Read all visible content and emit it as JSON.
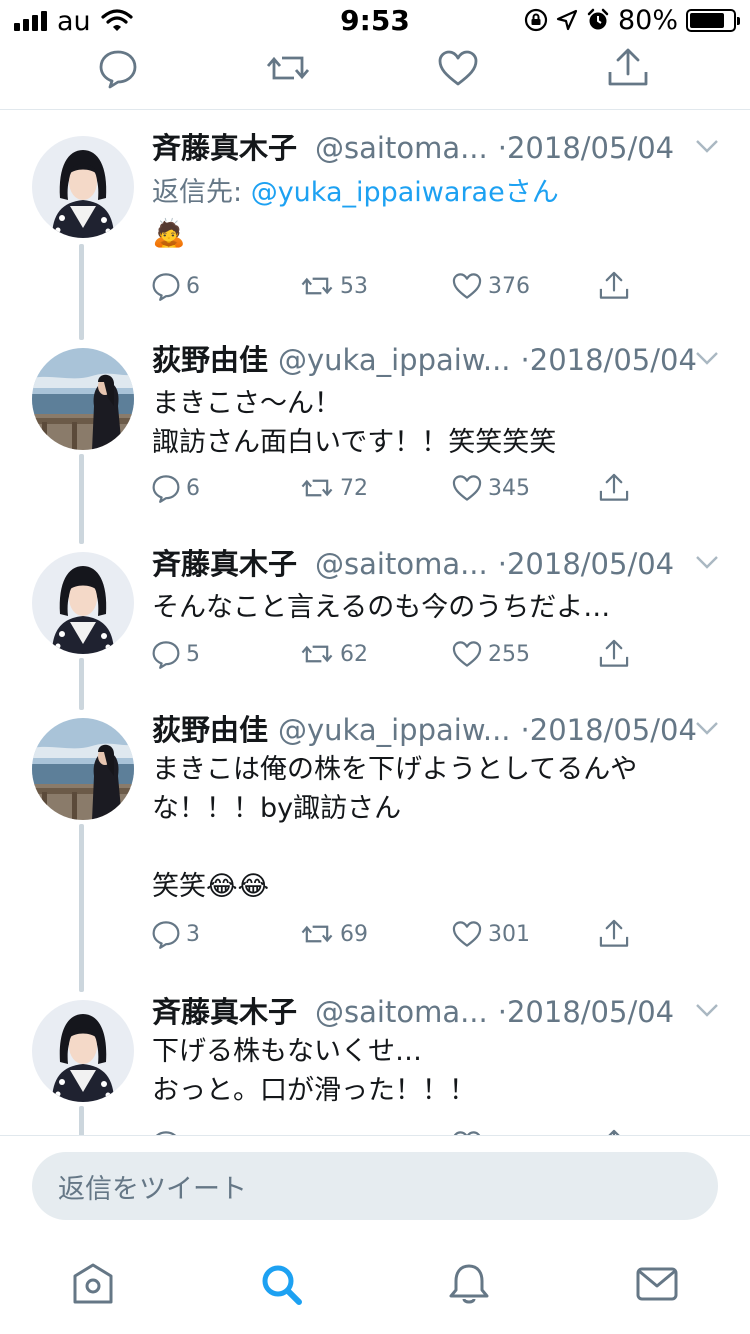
{
  "status_bar": {
    "carrier": "au",
    "time": "9:53",
    "battery_percent": "80%",
    "battery_level": 0.8
  },
  "thread": [
    {
      "name": "斉藤真木子",
      "verified": true,
      "handle": "@saitoma...",
      "dot": "·",
      "date": "2018/05/04",
      "avatar": "avatar-saito",
      "reply_to_prefix": "返信先: ",
      "reply_to_handle": "@yuka_ippaiwarae",
      "reply_to_suffix": "さん",
      "body": [
        "🙇"
      ],
      "replies": "6",
      "retweets": "53",
      "likes": "376"
    },
    {
      "name": "荻野由佳",
      "verified": false,
      "handle": "@yuka_ippaiw...",
      "dot": "·",
      "date": "2018/05/04",
      "avatar": "avatar-ogino",
      "body": [
        "まきこさ〜ん！",
        "諏訪さん面白いです！！笑笑笑笑"
      ],
      "replies": "6",
      "retweets": "72",
      "likes": "345"
    },
    {
      "name": "斉藤真木子",
      "verified": true,
      "handle": "@saitoma...",
      "dot": "·",
      "date": "2018/05/04",
      "avatar": "avatar-saito",
      "body": [
        "そんなこと言えるのも今のうちだよ…"
      ],
      "replies": "5",
      "retweets": "62",
      "likes": "255"
    },
    {
      "name": "荻野由佳",
      "verified": false,
      "handle": "@yuka_ippaiw...",
      "dot": "·",
      "date": "2018/05/04",
      "avatar": "avatar-ogino",
      "body": [
        "まきこは俺の株を下げようとしてるんや",
        "な！！！by諏訪さん",
        "",
        "笑笑😂😂"
      ],
      "replies": "3",
      "retweets": "69",
      "likes": "301"
    },
    {
      "name": "斉藤真木子",
      "verified": true,
      "handle": "@saitoma...",
      "dot": "·",
      "date": "2018/05/04",
      "avatar": "avatar-saito",
      "body": [
        "下げる株もないくせ…",
        "おっと。口が滑った！！！"
      ]
    }
  ],
  "composer": {
    "placeholder": "返信をツイート"
  },
  "tabbar": [
    "home-icon",
    "search-icon",
    "notifications-icon",
    "messages-icon"
  ],
  "colors": {
    "accent": "#1da1f2",
    "muted": "#657786",
    "text": "#14171a",
    "thread_line": "#ccd6dd",
    "divider": "#e1e8ed",
    "input_bg": "#e6ecf0"
  }
}
